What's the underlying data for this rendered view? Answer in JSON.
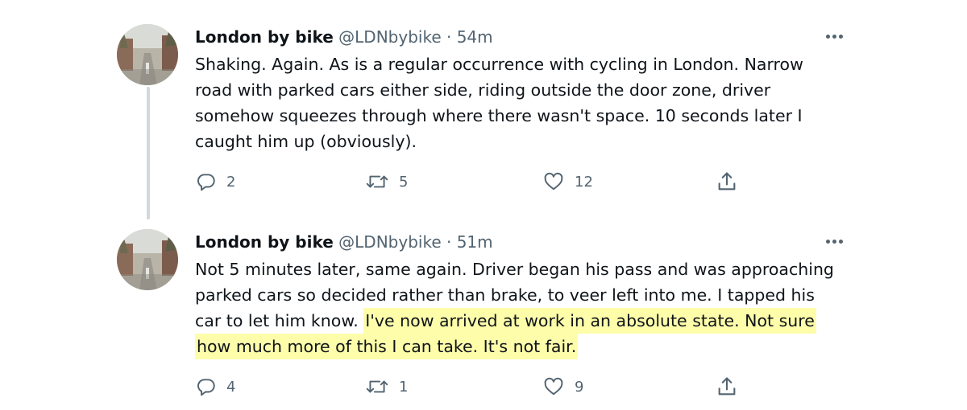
{
  "colors": {
    "text_primary": "#0f1419",
    "text_secondary": "#536471",
    "thread_line": "#cfd9de",
    "highlight": "#fdfdaa"
  },
  "tweets": [
    {
      "display_name": "London by bike",
      "handle": "@LDNbybike",
      "separator": "·",
      "time": "54m",
      "text_plain": "Shaking. Again. As is a regular occurrence with cycling in London. Narrow road with parked cars either side, riding outside the door zone, driver somehow squeezes through where there wasn't space. 10 seconds later I caught him up (obviously).",
      "text_highlighted": "",
      "reply_count": "2",
      "retweet_count": "5",
      "like_count": "12",
      "icons": [
        "avatar",
        "more-icon",
        "reply-icon",
        "retweet-icon",
        "like-icon",
        "share-icon"
      ]
    },
    {
      "display_name": "London by bike",
      "handle": "@LDNbybike",
      "separator": "·",
      "time": "51m",
      "text_plain": "Not 5 minutes later, same again. Driver began his pass and was approaching parked cars so decided rather than brake, to veer left into me. I tapped his car to let him know. ",
      "text_highlighted": "I've now arrived at work in an absolute state. Not sure how much more of this I can take. It's not fair.",
      "reply_count": "4",
      "retweet_count": "1",
      "like_count": "9",
      "icons": [
        "avatar",
        "more-icon",
        "reply-icon",
        "retweet-icon",
        "like-icon",
        "share-icon"
      ]
    }
  ]
}
